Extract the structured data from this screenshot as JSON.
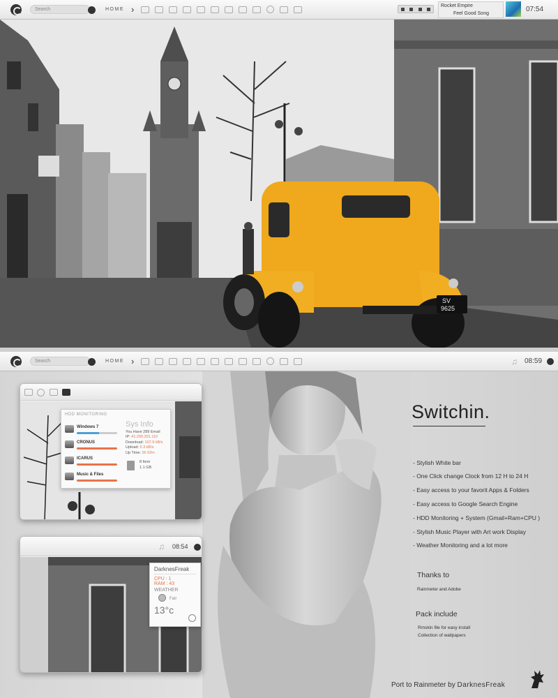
{
  "topbar1": {
    "search_placeholder": "Search",
    "home": "HOME",
    "clock": "07:54"
  },
  "player": {
    "artist": "Rocket Empire",
    "song": "Feel Good Song"
  },
  "topbar2": {
    "search_placeholder": "Search",
    "home": "HOME",
    "clock": "08:59",
    "note_icon": "♫"
  },
  "plate": "SV 9625",
  "hdd": {
    "title": "HDD MONITORING",
    "drives": [
      {
        "name": "Windows 7"
      },
      {
        "name": "CRONUS"
      },
      {
        "name": "ICARUS"
      },
      {
        "name": "Music & Files"
      }
    ]
  },
  "sysinfo": {
    "heading": "Sys Info",
    "email": "You Have 289 Email",
    "ip_label": "IP:",
    "ip": "41.200.201.110",
    "download_label": "Download:",
    "download": "107.9 kB/s",
    "upload_label": "Upload:",
    "upload": "5.3 kB/s",
    "uptime_label": "Up Time:",
    "uptime": "3h 52m",
    "items": "8 Item",
    "size": "1.1 GB"
  },
  "mini_clock": "08:54",
  "weather": {
    "user": "DarknesFreak",
    "cpu": "CPU : 1",
    "ram": "RAM : 43",
    "label": "WEATHER",
    "cond": "Fair",
    "temp": "13°c"
  },
  "main": {
    "title": "Switchin.",
    "features": [
      "- Stylish White bar",
      "- One Click change Clock from 12 H to 24 H",
      "- Easy access to your favorit Apps & Folders",
      "- Easy access to Google Search Engine",
      "- HDD Monitoring + System (Gmail+Ram+CPU )",
      "- Stylish Music Player with Art work Display",
      "- Weather Monitoring and a lot more"
    ],
    "thanks_heading": "Thanks to",
    "thanks_body": "Rainmeter and Adobe",
    "pack_heading": "Pack include",
    "pack_items": [
      "Rmskin file for easy install",
      "Collection of wallpapers"
    ],
    "credit_prefix": "Port to Rainmeter by",
    "credit_name": "DarknesFreak"
  }
}
